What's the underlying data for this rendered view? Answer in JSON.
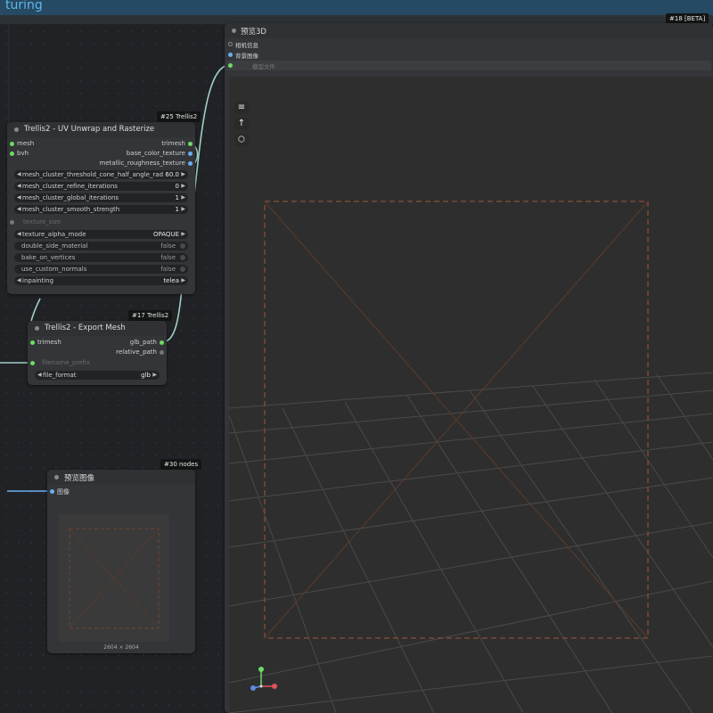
{
  "app": {
    "title_fragment": "turing"
  },
  "node_3d": {
    "badge": "#18 [BETA]",
    "title": "预览3D",
    "inputs": [
      "相机信息",
      "背景图像",
      "模型文件"
    ]
  },
  "node_uv": {
    "badge": "#25 Trellis2",
    "title": "Trellis2 - UV Unwrap and Rasterize",
    "inputs": [
      "mesh",
      "bvh"
    ],
    "outputs": [
      "trimesh",
      "base_color_texture",
      "metallic_roughness_texture"
    ],
    "widgets": [
      {
        "label": "mesh_cluster_threshold_cone_half_angle_rad",
        "value": "60.0"
      },
      {
        "label": "mesh_cluster_refine_iterations",
        "value": "0"
      },
      {
        "label": "mesh_cluster_global_iterations",
        "value": "1"
      },
      {
        "label": "mesh_cluster_smooth_strength",
        "value": "1"
      }
    ],
    "texture_size_label": "texture_size",
    "texture_alpha_mode": {
      "label": "texture_alpha_mode",
      "value": "OPAQUE"
    },
    "toggles": [
      {
        "label": "double_side_material",
        "value": "false"
      },
      {
        "label": "bake_on_vertices",
        "value": "false"
      },
      {
        "label": "use_custom_normals",
        "value": "false"
      }
    ],
    "inpainting": {
      "label": "inpainting",
      "value": "telea"
    }
  },
  "node_export": {
    "badge": "#17 Trellis2",
    "title": "Trellis2 - Export Mesh",
    "inputs": [
      "trimesh"
    ],
    "outputs": [
      "glb_path",
      "relative_path"
    ],
    "filename_prefix": "filename_prefix",
    "file_format": {
      "label": "file_format",
      "value": "glb"
    }
  },
  "node_preview": {
    "badge": "#30 nodes",
    "title": "预览图像",
    "input": "图像",
    "dimensions": "2604 × 2604"
  },
  "colors": {
    "link": "#9fd0c4",
    "link_blue": "#6aaef2",
    "pin_green": "#6cdc64",
    "pin_blue": "#6aaef2",
    "topbar": "#264a63"
  },
  "icons": [
    "menu-icon",
    "arrow-up-icon",
    "cube-icon",
    "axis-gizmo-icon"
  ]
}
